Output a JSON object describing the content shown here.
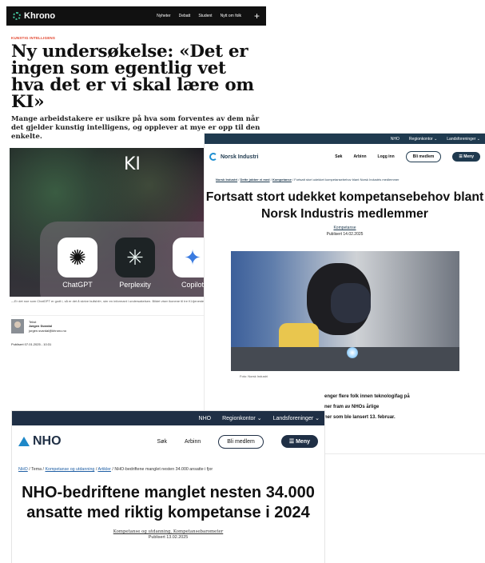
{
  "khrono": {
    "brand": "Khrono",
    "nav": [
      "Nyheter",
      "Debatt",
      "Student",
      "Nytt om folk"
    ],
    "kicker": "KUNSTIG INTELLIGENS",
    "title": "Ny undersøkelse: «Det er ingen som egentlig vet hva det er vi skal lære om KI»",
    "lede": "Mange arbeidstakere er usikre på hva som forventes av dem når det gjelder kunstig intelligens, og opplever at mye er opp til den enkelte.",
    "image": {
      "overlay": "KI",
      "apps": [
        "ChatGPT",
        "Perplexity",
        "Copilot"
      ]
    },
    "caption": "—Er det noe som ChatGPT er godt i, så er det å skrive bullshit», sier en informant i undersøkelsen. Bildet viser ikonene til tre KI-tjenester. Copilot. Foto: Jørgen Svardal",
    "author": {
      "role": "Tekst",
      "name": "Jørgen Svardal",
      "email": "jorgen.svardal@khrono.no"
    },
    "published": "Publisert 07.01.2025 - 10:31"
  },
  "norsk_industri": {
    "top_nav": [
      "NHO",
      "Regionkontor",
      "Landsforeninger"
    ],
    "brand": "Norsk Industri",
    "nav": [
      "Søk",
      "Arbinn",
      "Logg inn"
    ],
    "member_button": "Bli medlem",
    "menu_button": "Meny",
    "breadcrumb": [
      "Norsk Industri",
      "Dette jobber vi med",
      "Kompetanse",
      "Fortsatt stort udekket kompetansebehov blant Norsk Industris medlemmer"
    ],
    "title": "Fortsatt stort udekket kompetansebehov blant Norsk Industris medlemmer",
    "tag": "Kompetanse",
    "date": "Publisert 14.02.2025",
    "image_caption": "Foto: Norsk Industri",
    "body_lines": [
      "enger flere folk innen teknologifag på",
      "ner fram av NHOs årlige",
      "ner som ble lansert 13. februar."
    ]
  },
  "nho": {
    "top_nav": [
      "NHO",
      "Regionkontor",
      "Landsforeninger"
    ],
    "brand": "NHO",
    "nav": [
      "Søk",
      "Arbinn"
    ],
    "member_button": "Bli medlem",
    "menu_button": "Meny",
    "breadcrumb": {
      "root": "NHO",
      "items": [
        "Tema",
        "Kompetanse og utdanning",
        "Artikler"
      ],
      "current": "NHO-bedriftene manglet nesten 34.000 ansatte i fjor"
    },
    "title": "NHO-bedriftene manglet nesten 34.000 ansatte med riktig kompetanse i 2024",
    "tags": "Kompetanse og utdanning, Kompetansebarometer",
    "date": "Publisert 13.02.2025"
  }
}
